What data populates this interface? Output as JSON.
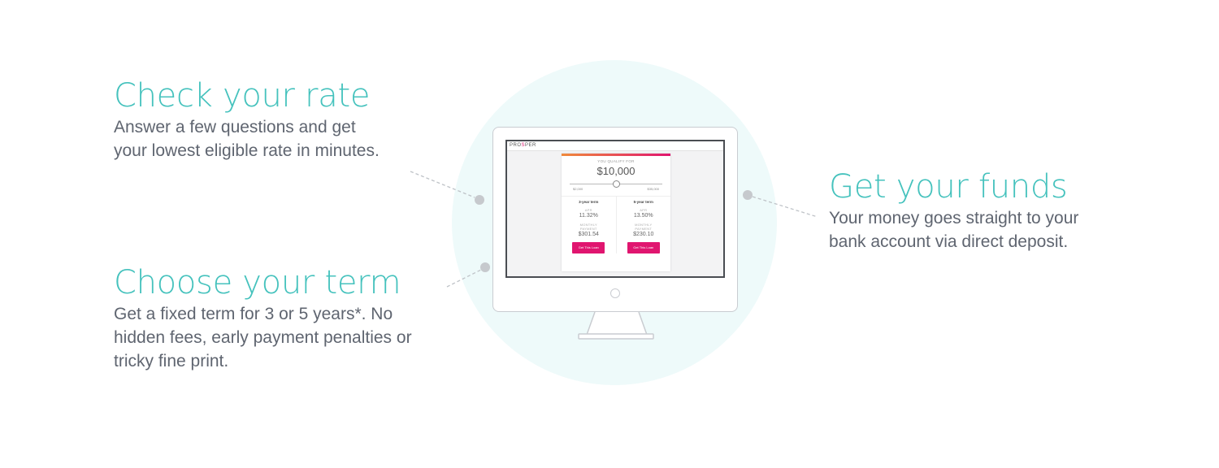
{
  "steps": {
    "rate": {
      "title": "Check your rate",
      "line1": "Answer a few questions and get",
      "line2": "your lowest eligible rate in minutes."
    },
    "term": {
      "title": "Choose your term",
      "line1": "Get a fixed term for 3 or 5 years*. No",
      "line2": "hidden fees, early payment penalties or",
      "line3": "tricky fine print."
    },
    "funds": {
      "title": "Get your funds",
      "line1": "Your money goes straight to your",
      "line2": "bank account via direct deposit."
    }
  },
  "mockup": {
    "logo_left": "PRO",
    "logo_mark": "S",
    "logo_right": "PER",
    "qualify_label": "YOU QUALIFY FOR",
    "amount": "$10,000",
    "slider_min": "$2,000",
    "slider_max": "$35,000",
    "slider_level": 0.5,
    "terms": [
      {
        "name": "3-year term",
        "apr_label": "APR",
        "apr": "11.32%",
        "payment_label_1": "MONTHLY",
        "payment_label_2": "PAYMENT",
        "payment": "$301.54",
        "button": "Get This Loan"
      },
      {
        "name": "5-year term",
        "apr_label": "APR",
        "apr": "13.50%",
        "payment_label_1": "MONTHLY",
        "payment_label_2": "PAYMENT",
        "payment": "$230.10",
        "button": "Get This Loan"
      }
    ]
  },
  "colors": {
    "heading": "#45c2bd",
    "body_text": "#5f6570",
    "circle_bg": "#eefafa",
    "accent_pink": "#e0156f",
    "accent_orange": "#f08a3c"
  }
}
